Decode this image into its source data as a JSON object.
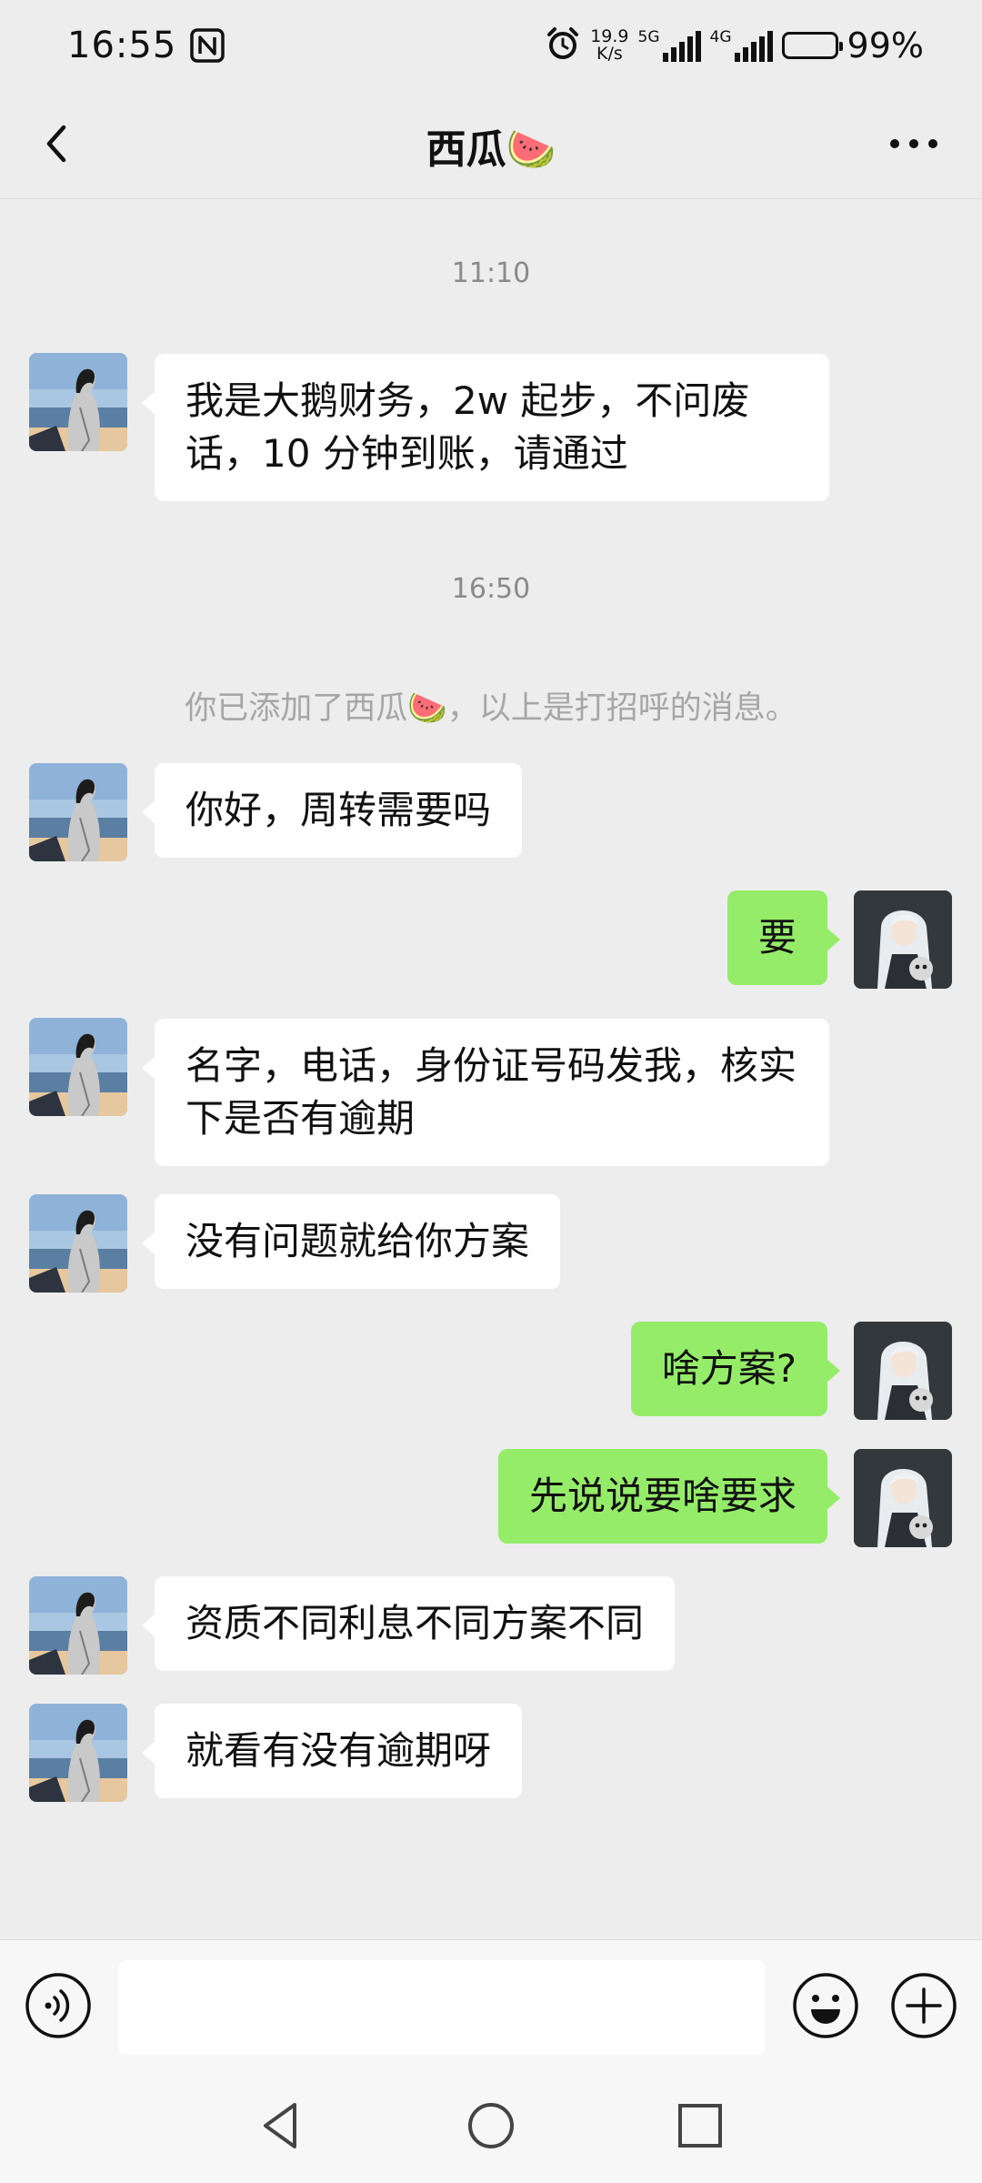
{
  "status_bar": {
    "time": "16:55",
    "net_speed_value": "19.9",
    "net_speed_unit": "K/s",
    "sig1_label": "5G",
    "sig2_label": "4G",
    "battery_percent": "99%",
    "battery_level": 0.99
  },
  "header": {
    "title": "西瓜🍉"
  },
  "messages": {
    "ts1": "11:10",
    "m1": "我是大鹅财务，2w 起步，不问废话，10 分钟到账，请通过",
    "ts2": "16:50",
    "sys1": "你已添加了西瓜🍉，以上是打招呼的消息。",
    "m2": "你好，周转需要吗",
    "m3": "要",
    "m4": "名字，电话，身份证号码发我，核实下是否有逾期",
    "m5": "没有问题就给你方案",
    "m6": "啥方案?",
    "m7": "先说说要啥要求",
    "m8": "资质不同利息不同方案不同",
    "m9": "就看有没有逾期呀"
  },
  "input_bar": {
    "value": ""
  },
  "icons": {
    "back": "chevron-left-icon",
    "more": "more-horizontal-icon",
    "voice": "voice-icon",
    "emoji": "smiley-icon",
    "plus": "plus-icon",
    "nav_back": "triangle-back-icon",
    "nav_home": "circle-home-icon",
    "nav_recents": "square-recents-icon"
  },
  "colors": {
    "background": "#ededed",
    "incoming_bubble": "#ffffff",
    "outgoing_bubble": "#95ec69",
    "timestamp_text": "#8a8a8a"
  }
}
